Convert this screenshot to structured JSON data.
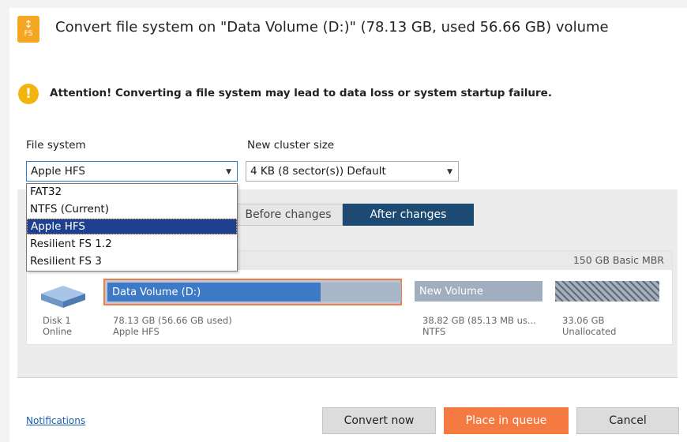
{
  "dialog": {
    "icon_text": "FS",
    "icon_glyph": "↕",
    "title": "Convert file system on \"Data Volume (D:)\" (78.13 GB, used 56.66 GB) volume",
    "warning_icon": "!",
    "warning": "Attention! Converting a file system may lead to data loss or system startup failure."
  },
  "form": {
    "fs_label": "File system",
    "fs_value": "Apple HFS",
    "cluster_label": "New cluster size",
    "cluster_value": "4 KB (8 sector(s)) Default",
    "fs_options": [
      "FAT32",
      "NTFS (Current)",
      "Apple HFS",
      "Resilient FS 1.2",
      "Resilient FS 3"
    ],
    "fs_selected_index": 2
  },
  "tabs": {
    "before": "Before changes",
    "after": "After changes",
    "active": "after"
  },
  "disk": {
    "header": "150 GB Basic MBR",
    "name": "Disk 1",
    "status": "Online",
    "volumes": [
      {
        "name": "Data Volume (D:)",
        "size": "78.13 GB (56.66 GB used)",
        "fs": "Apple HFS",
        "used_fraction": 0.725
      },
      {
        "name": "New Volume",
        "size": "38.82 GB (85.13 MB us...",
        "fs": "NTFS"
      },
      {
        "name": "",
        "size": "33.06 GB",
        "fs": "Unallocated"
      }
    ]
  },
  "footer": {
    "notifications": "Notifications",
    "convert": "Convert now",
    "queue": "Place in queue",
    "cancel": "Cancel"
  },
  "colors": {
    "accent": "#f47a42",
    "tab_active": "#1c4a73",
    "volume_blue": "#3e79c5",
    "selection": "#1f3f8f",
    "warning": "#f2b50f"
  }
}
